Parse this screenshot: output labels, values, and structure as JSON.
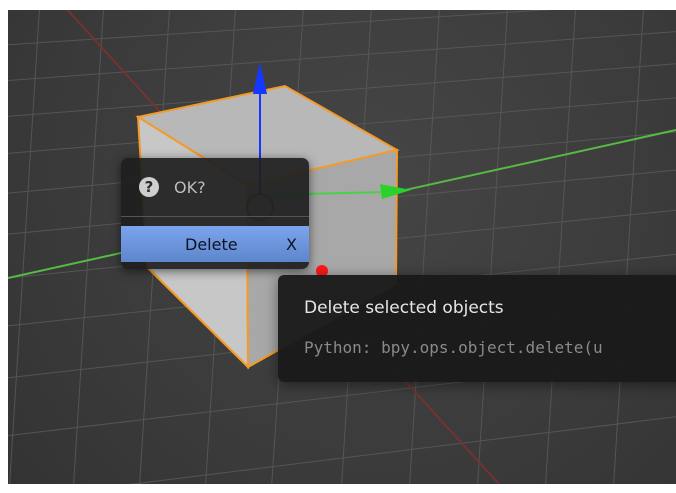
{
  "popup": {
    "title": "OK?",
    "help_icon": "question-mark-icon",
    "delete_label": "Delete",
    "delete_shortcut": "X"
  },
  "tooltip": {
    "description": "Delete selected objects",
    "python": "Python: bpy.ops.object.delete(u"
  },
  "colors": {
    "viewport_bg": "#3c3c3c",
    "grid": "#595959",
    "x_axis": "#7a3030",
    "y_axis": "#56b848",
    "z_axis": "#1a3cff",
    "selection_outline": "#f39a28",
    "menu_highlight": "#6d94db"
  }
}
